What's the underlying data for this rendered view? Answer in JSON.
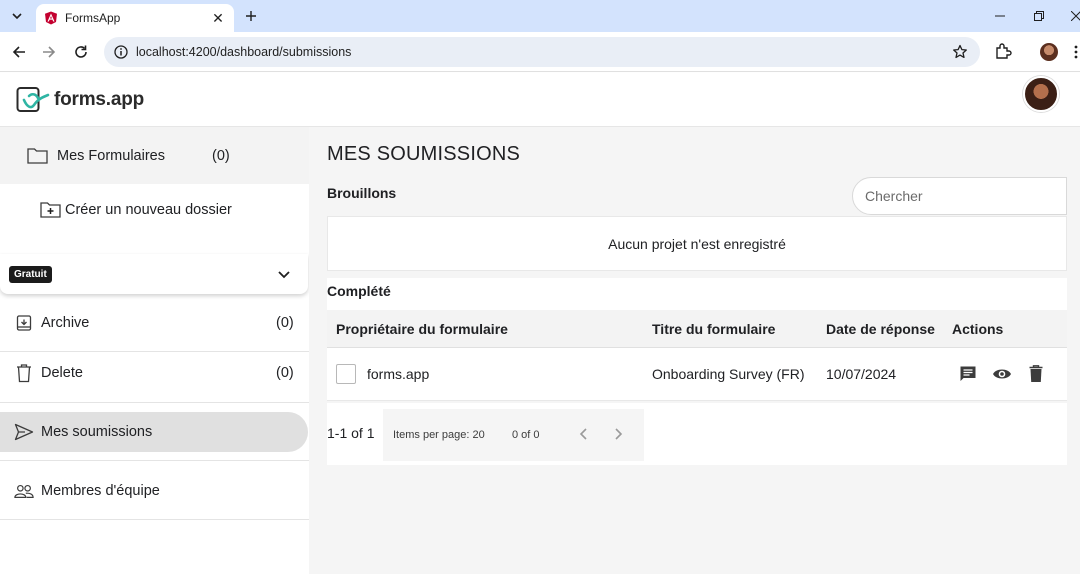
{
  "browser": {
    "tab_title": "FormsApp",
    "url": "localhost:4200/dashboard/submissions"
  },
  "header": {
    "logo_text": "forms.app"
  },
  "sidebar": {
    "forms": {
      "label": "Mes Formulaires",
      "count": "(0)"
    },
    "new_folder": "Créer un nouveau dossier",
    "plan_badge": "Gratuit",
    "items": [
      {
        "label": "Archive",
        "count": "(0)",
        "icon": "archive-icon"
      },
      {
        "label": "Delete",
        "count": "(0)",
        "icon": "trash-icon"
      },
      {
        "label": "Mes soumissions",
        "count": "",
        "icon": "send-icon"
      },
      {
        "label": "Membres d'équipe",
        "count": "",
        "icon": "team-icon"
      }
    ]
  },
  "main": {
    "title": "MES SOUMISSIONS",
    "drafts_label": "Brouillons",
    "search_placeholder": "Chercher",
    "drafts_empty": "Aucun projet n'est enregistré",
    "completed_label": "Complété",
    "table": {
      "headers": [
        "Propriétaire du formulaire",
        "Titre du formulaire",
        "Date de réponse",
        "Actions"
      ],
      "rows": [
        {
          "owner": "forms.app",
          "title": "Onboarding Survey (FR)",
          "date": "10/07/2024"
        }
      ]
    },
    "paginator": {
      "range": "1-1 of 1",
      "items_per_page": "Items per page: 20",
      "of_text": "0 of 0"
    }
  },
  "colors": {
    "brand_logo": "#2fb5a4",
    "active_item_bg": "#e0e0e0",
    "main_bg": "#f5f5f5"
  }
}
